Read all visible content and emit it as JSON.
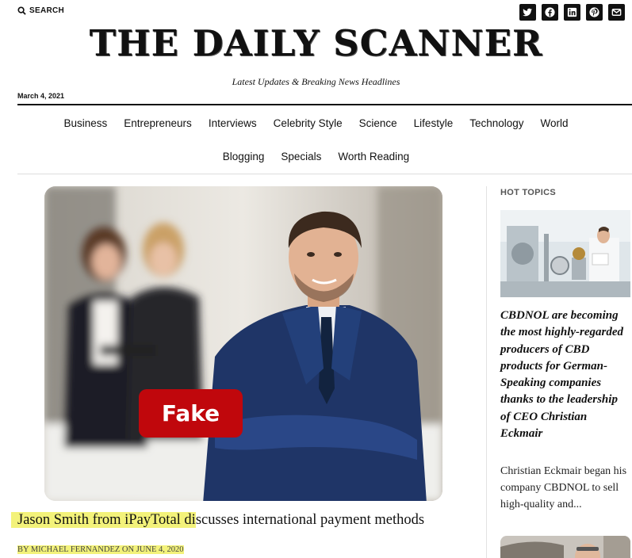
{
  "header": {
    "search_label": "SEARCH",
    "masthead": "THE DAILY SCANNER",
    "tagline": "Latest Updates & Breaking News Headlines",
    "date": "March 4, 2021",
    "socials": [
      "twitter-icon",
      "facebook-icon",
      "linkedin-icon",
      "pinterest-icon",
      "email-icon"
    ]
  },
  "nav": {
    "row1": [
      "Business",
      "Entrepreneurs",
      "Interviews",
      "Celebrity Style",
      "Science",
      "Lifestyle",
      "Technology",
      "World"
    ],
    "row2": [
      "Blogging",
      "Specials",
      "Worth Reading"
    ]
  },
  "article": {
    "badge": "Fake",
    "headline_highlight": "Jason Smith from iPayTotal di",
    "headline_rest": "scusses international payment methods",
    "byline_highlight": "BY MICHAEL FERNANDEZ ON JUNE 4, 2020"
  },
  "sidebar": {
    "heading": "HOT TOPICS",
    "title": "CBDNOL are becoming the most highly-regarded producers of CBD products for German-Speaking companies thanks to the leadership of CEO Christian Eckmair",
    "excerpt": "Christian Eckmair began his company CBDNOL to sell high-quality and..."
  },
  "colors": {
    "badge": "#c0070c",
    "highlight": "#f3f27a",
    "text": "#111111"
  }
}
